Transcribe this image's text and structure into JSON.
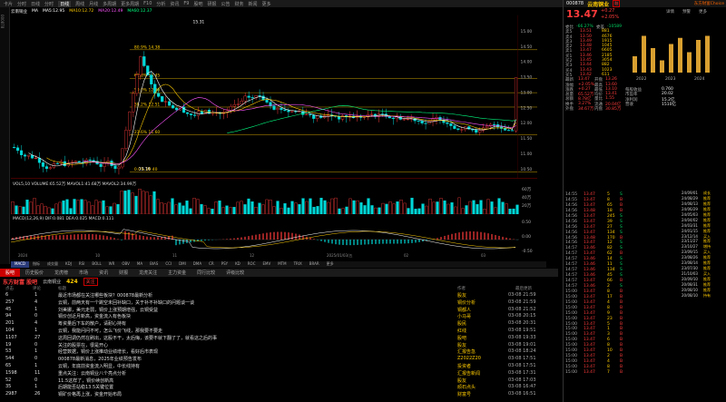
{
  "app": {
    "top_tabs": [
      "卡片",
      "分时",
      "日线",
      "分时",
      "日线",
      "周线",
      "月线",
      "多周期",
      "更多周期",
      "F10",
      "分析",
      "资讯",
      "F9",
      "股吧",
      "研报",
      "公告",
      "财务",
      "新闻",
      "更多"
    ],
    "active_tab": "日线"
  },
  "stock": {
    "code": "000878",
    "name": "云南铜业",
    "price": "13.47",
    "change": "+0.27",
    "pct": "+2.05%",
    "tag": "融",
    "brand": "东方财富Choice"
  },
  "chart": {
    "title": "云南铜业",
    "ma_labels": [
      "MA",
      "MA5:12.95",
      "MA10:12.72",
      "MA20:12.49",
      "MA60:12.37"
    ],
    "price_labels": [
      "15.31",
      "13.16"
    ],
    "fib_labels": [
      "80.9% 14.38",
      "61.8% 13.45",
      "50.0% 12.98",
      "38.2% 12.51",
      "23.6% 11.60",
      "0.0% 10.40"
    ],
    "yaxis": [
      "15.00",
      "14.50",
      "14.00",
      "13.50",
      "13.00",
      "12.50",
      "12.00",
      "11.50",
      "11.00",
      "10.50"
    ],
    "vol_label": "VOL5,10 VOLUME:65.52万 MAVOL1:41.68万 MAVOL2:34.99万",
    "macd_label": "MACD(12,26,9) DIF:0.081 DEA:0.025 MACD:0.111",
    "xaxis": [
      "2024",
      "10",
      "11",
      "12",
      "2025/01/03/五",
      "02",
      "03"
    ],
    "vol_y": [
      "60万",
      "40万",
      "20万"
    ],
    "macd_y": [
      "0.50",
      "0.00",
      "-0.50"
    ]
  },
  "indicator_tabs": [
    "指标",
    "成交量",
    "KDJ",
    "RSI",
    "BOLL",
    "WR",
    "OBV",
    "MA",
    "BIAS",
    "CCI",
    "DMI",
    "DMA",
    "CR",
    "PSY",
    "KD",
    "ROC",
    "EMV",
    "MTM",
    "TRIX",
    "BRAR",
    "更多"
  ],
  "active_indicator": "MACD",
  "bottom_tabs": [
    "股吧",
    "历史股价",
    "龙虎榜",
    "市场",
    "资讯",
    "财报",
    "龙虎关注",
    "主力资金",
    "同行比较",
    "评级比较"
  ],
  "forum": {
    "title": "东方财富 股吧",
    "code_tag": "云南铜业",
    "count": "424",
    "follow": "关注",
    "head": [
      "点击",
      "评论",
      "标题",
      "作者",
      "最后更新"
    ],
    "rows": [
      {
        "click": "6",
        "cmt": "1",
        "title": "最近市场都在关注哪些板块？000878最新分析",
        "author": "股友",
        "time": "03-08 21:59"
      },
      {
        "click": "257",
        "cmt": "4",
        "title": "云铜，前两天有一个跳空未回补缺口，关于补不补缺口的问题谈一谈",
        "author": "铜价分析",
        "time": "03-08 21:59"
      },
      {
        "click": "45",
        "cmt": "1",
        "title": "刘美娜，美元走弱，铜价上涨预期增强，云铜受益",
        "author": "铜都人",
        "time": "03-08 21:52"
      },
      {
        "click": "94",
        "cmt": "0",
        "title": "铜价创近月新高，资金流入有色板块",
        "author": "小马哥",
        "time": "03-08 20:15"
      },
      {
        "click": "201",
        "cmt": "4",
        "title": "筹资量后下车的散户，请耐心持有",
        "author": "股民",
        "time": "03-08 20:31"
      },
      {
        "click": "104",
        "cmt": "1",
        "title": "云铜，我能问问不可，怎么飞价飞线，那我要不要走",
        "author": "红线",
        "time": "03-08 19:51"
      },
      {
        "click": "1107",
        "cmt": "27",
        "title": "这周回调仍然在刷出，这股不干，太后悔，该要不就下翻了了，就看这之后的事",
        "author": "股吧",
        "time": "03-08 19:33"
      },
      {
        "click": "19",
        "cmt": "0",
        "title": "关注的股票在，很是开心",
        "author": "股友",
        "time": "03-08 19:01"
      },
      {
        "click": "53",
        "cmt": "1",
        "title": "经营数据，铜价上涨推动业绩增长，看好后市表现",
        "author": "汇报告急",
        "time": "03-08 18:24"
      },
      {
        "click": "544",
        "cmt": "0",
        "title": "000878最新消息，2025年业绩预告发布",
        "author": "Z2022Z20",
        "time": "03-08 17:51"
      },
      {
        "click": "65",
        "cmt": "1",
        "title": "云铜，年底前资金流入明显，中长线持有",
        "author": "投资者",
        "time": "03-08 17:51"
      },
      {
        "click": "1598",
        "cmt": "11",
        "title": "重点关注：云南铜业八个亮点分析",
        "author": "汇报告新闻",
        "time": "03-08 17:31"
      },
      {
        "click": "52",
        "cmt": "0",
        "title": "11.5这样了，铜价续创新高",
        "author": "股友",
        "time": "03-08 17:03"
      },
      {
        "click": "35",
        "cmt": "1",
        "title": "后期能否站稳13.5关键位置",
        "author": "顽石点头",
        "time": "03-08 16:47"
      },
      {
        "click": "2987",
        "cmt": "26",
        "title": "铜矿价格再上涨，资金开始布局",
        "author": "财富号",
        "time": "03-08 16:51"
      }
    ]
  },
  "right": {
    "header_tabs": [
      "融",
      "详情",
      "预警",
      "更多"
    ],
    "ratios": [
      [
        "委比",
        "-66.27%",
        "委差",
        "-10589"
      ]
    ],
    "asks": [
      [
        "卖5",
        "13.51",
        "881"
      ],
      [
        "卖4",
        "13.50",
        "4676"
      ],
      [
        "卖3",
        "13.49",
        "1915"
      ],
      [
        "卖2",
        "13.48",
        "1045"
      ],
      [
        "卖1",
        "13.47",
        "6605"
      ]
    ],
    "bids": [
      [
        "买1",
        "13.46",
        "2185"
      ],
      [
        "买2",
        "13.45",
        "3054"
      ],
      [
        "买3",
        "13.44",
        "882"
      ],
      [
        "买4",
        "13.43",
        "1023"
      ],
      [
        "买5",
        "13.42",
        "611"
      ]
    ],
    "stats": [
      [
        "最新",
        "13.47",
        "开盘",
        "13.26"
      ],
      [
        "涨幅",
        "+2.05%",
        "最高",
        "13.60"
      ],
      [
        "涨跌",
        "+0.27",
        "最低",
        "13.10"
      ],
      [
        "总量",
        "65.52万",
        "均价",
        "13.41"
      ],
      [
        "总额",
        "8.78亿",
        "量比",
        "1.55"
      ],
      [
        "换手",
        "3.27%",
        "流通",
        "20.04亿"
      ],
      [
        "外盘",
        "34.67万",
        "内盘",
        "30.85万"
      ]
    ],
    "ticks": [
      [
        "14:55",
        "13.47",
        "5",
        "S"
      ],
      [
        "14:55",
        "13.47",
        "8",
        "B"
      ],
      [
        "14:56",
        "13.47",
        "65",
        "B"
      ],
      [
        "14:56",
        "13.48",
        "18",
        "B"
      ],
      [
        "14:56",
        "13.47",
        "245",
        "S"
      ],
      [
        "14:56",
        "13.47",
        "39",
        "S"
      ],
      [
        "14:56",
        "13.47",
        "27",
        "S"
      ],
      [
        "14:56",
        "13.47",
        "134",
        "S"
      ],
      [
        "14:56",
        "13.48",
        "170",
        "B"
      ],
      [
        "14:56",
        "13.47",
        "12",
        "S"
      ],
      [
        "14:57",
        "13.46",
        "82",
        "S"
      ],
      [
        "14:57",
        "13.47",
        "62",
        "B"
      ],
      [
        "14:57",
        "13.46",
        "14",
        "S"
      ],
      [
        "14:57",
        "13.46",
        "11",
        "S"
      ],
      [
        "14:57",
        "13.46",
        "134",
        "S"
      ],
      [
        "14:57",
        "13.46",
        "45",
        "S"
      ],
      [
        "14:57",
        "13.47",
        "66",
        "B"
      ],
      [
        "14:57",
        "13.46",
        "2",
        "S"
      ],
      [
        "15:00",
        "13.47",
        "8",
        "B"
      ],
      [
        "15:00",
        "13.47",
        "17",
        "B"
      ],
      [
        "15:00",
        "13.47",
        "4",
        "B"
      ],
      [
        "15:00",
        "13.47",
        "8",
        "B"
      ],
      [
        "15:00",
        "13.47",
        "9",
        "B"
      ],
      [
        "15:00",
        "13.47",
        "23",
        "B"
      ],
      [
        "15:00",
        "13.47",
        "5",
        "B"
      ],
      [
        "15:00",
        "13.47",
        "1",
        "B"
      ],
      [
        "15:00",
        "13.47",
        "3",
        "B"
      ],
      [
        "15:00",
        "13.47",
        "6",
        "B"
      ],
      [
        "15:00",
        "13.47",
        "8",
        "B"
      ],
      [
        "15:00",
        "13.47",
        "10",
        "B"
      ],
      [
        "15:00",
        "13.47",
        "2",
        "B"
      ],
      [
        "15:00",
        "13.47",
        "4",
        "B"
      ],
      [
        "15:00",
        "13.47",
        "8",
        "B"
      ],
      [
        "15:00",
        "13.47",
        "7",
        "B"
      ]
    ],
    "fin_rows": [
      [
        "每股收益",
        "0.760"
      ],
      [
        "市盈率",
        "20.02"
      ],
      [
        "净利润",
        "15.2亿"
      ],
      [
        "营收",
        "1510亿"
      ]
    ],
    "bar_years": [
      "2022",
      "2023",
      "2024"
    ],
    "reports": [
      [
        "24/09/01",
        "成长"
      ],
      [
        "24/08/29",
        "推荐"
      ],
      [
        "24/08/13",
        "推荐"
      ],
      [
        "24/06/29",
        "推荐"
      ],
      [
        "24/05/03",
        "推荐"
      ],
      [
        "24/04/02",
        "推荐"
      ],
      [
        "24/03/31",
        "推荐"
      ],
      [
        "24/01/15",
        "推荐"
      ],
      [
        "23/12/14",
        "买入"
      ],
      [
        "23/11/27",
        "推荐"
      ],
      [
        "23/10/27",
        "增持"
      ],
      [
        "23/09/15",
        "买入"
      ],
      [
        "23/08/26",
        "推荐"
      ],
      [
        "23/08/14",
        "推荐"
      ],
      [
        "23/07/30",
        "推荐"
      ],
      [
        "21/10/03",
        "买入"
      ],
      [
        "20/09/10",
        "推荐"
      ],
      [
        "20/08/31",
        "推荐"
      ],
      [
        "20/08/10",
        "推荐"
      ],
      [
        "20/08/10",
        "持有"
      ]
    ],
    "report_orgs": [
      "华西证券",
      "国信证券",
      "民生证券",
      "华泰证券",
      "国信证券",
      "方正证券",
      "中泰证券",
      "中泰证券",
      "平安证券",
      "中泰证券",
      "华安证券",
      "西部证券",
      "平安证券",
      "华西证券",
      "中泰证券",
      "西南证券",
      "中泰证券",
      "西南证券",
      "平安证券",
      "西南证券"
    ]
  }
}
